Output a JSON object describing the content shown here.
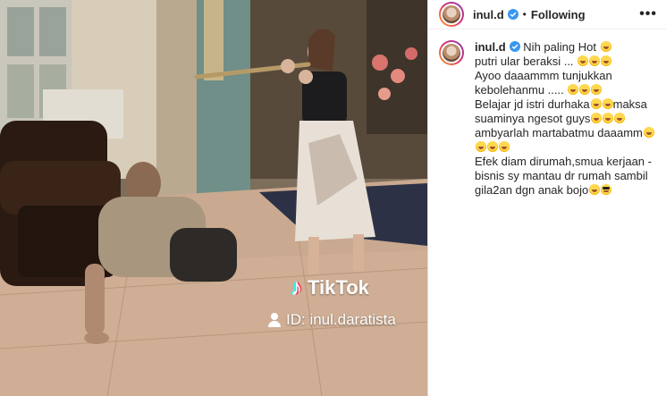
{
  "post": {
    "username": "inul.d",
    "following_label": "Following",
    "separator": "•",
    "more_label": "•••"
  },
  "media": {
    "watermark": {
      "app": "TikTok",
      "id": "ID: inul.daratista"
    }
  },
  "caption": {
    "lines": [
      "Nih paling Hot",
      "putri ular beraksi ...",
      "Ayoo daaammm tunjukkan",
      "kebolehanmu .....",
      "Belajar jd istri durhaka",
      "maksa",
      "suaminya ngesot guys",
      "ambyarlah martabatmu daaamm",
      "Efek diam dirumah,smua kerjaan -",
      "bisnis sy mantau dr rumah sambil",
      "gila2an dgn anak bojo"
    ]
  },
  "colors": {
    "verified": "#3897f0",
    "text": "#262626",
    "border": "#dbdbdb"
  },
  "icons": [
    "verified-badge-icon",
    "more-options-icon",
    "tiktok-note-icon",
    "person-icon",
    "rofl-emoji-icon",
    "sunglasses-emoji-icon"
  ]
}
